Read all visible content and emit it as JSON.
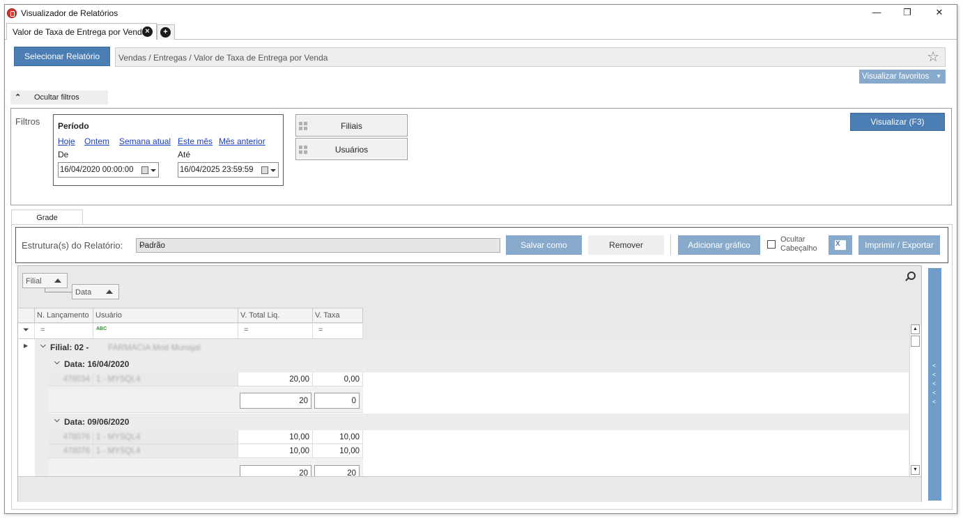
{
  "window": {
    "title": "Visualizador de Relatórios",
    "minimize": "—",
    "maximize": "❐",
    "close": "✕"
  },
  "tabs": [
    {
      "label": "Valor de Taxa de Entrega por Venda"
    }
  ],
  "toolbar": {
    "select_report": "Selecionar Relatório",
    "path": "Vendas / Entregas / Valor de Taxa de Entrega por Venda",
    "favorites": "Visualizar favoritos",
    "hide_filters": "Ocultar filtros"
  },
  "filters": {
    "label": "Filtros",
    "period": {
      "title": "Período",
      "shortcuts": [
        "Hoje",
        "Ontem",
        "Semana atual",
        "Este mês",
        "Mês anterior"
      ],
      "from_label": "De",
      "from_value": "16/04/2020 00:00:00",
      "to_label": "Até",
      "to_value": "16/04/2025 23:59:59"
    },
    "branches": "Filiais",
    "users": "Usuários",
    "view_button": "Visualizar (F3)"
  },
  "grade_tab": "Grade",
  "structure": {
    "label": "Estrutura(s) do Relatório:",
    "selected": "Padrão",
    "save_as": "Salvar como",
    "remove": "Remover",
    "add_chart": "Adicionar gráfico",
    "hide_header_line1": "Ocultar",
    "hide_header_line2": "Cabeçalho",
    "print_export": "Imprimir / Exportar"
  },
  "grid": {
    "group_chips": [
      "Filial",
      "Data"
    ],
    "columns": [
      "N. Lançamento",
      "Usuário",
      "V. Total Liq.",
      "V. Taxa"
    ],
    "filter_ops": [
      "=",
      "ABC",
      "=",
      "="
    ],
    "group_filial": {
      "label": "Filial: 02 -",
      "name": "FARMACIA Mod Munajal"
    },
    "date_groups": [
      {
        "label": "Data: 16/04/2020",
        "rows": [
          {
            "lanc": "478034",
            "user": "1 - MYSQL4",
            "total": "20,00",
            "taxa": "0,00"
          }
        ],
        "sum_total": "20",
        "sum_taxa": "0"
      },
      {
        "label": "Data: 09/06/2020",
        "rows": [
          {
            "lanc": "478076",
            "user": "1 - MYSQL4",
            "total": "10,00",
            "taxa": "10,00"
          },
          {
            "lanc": "478076",
            "user": "1 - MYSQL4",
            "total": "10,00",
            "taxa": "10,00"
          }
        ],
        "sum_total": "20",
        "sum_taxa": "20"
      }
    ]
  },
  "colors": {
    "accent": "#4a7eb4",
    "accent_light": "#87a9cc",
    "side_panel": "#6f9cc8"
  },
  "icons": [
    "app-report-icon",
    "close-tab-icon",
    "add-tab-icon",
    "star-icon",
    "chevron-up-icon",
    "calendar-icon",
    "grid-grip-icon",
    "excel-icon",
    "search-icon",
    "filter-icon",
    "expand-icon",
    "collapse-icon"
  ]
}
